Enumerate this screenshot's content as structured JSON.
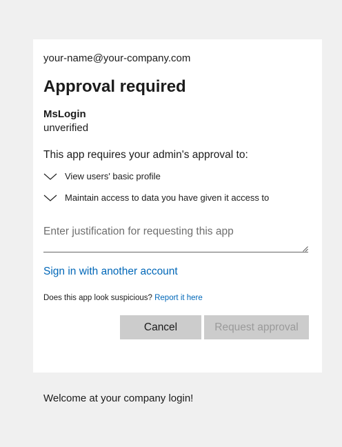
{
  "account": {
    "email": "your-name@your-company.com"
  },
  "dialog": {
    "title": "Approval required",
    "app_name": "MsLogin",
    "app_status": "unverified",
    "intro": "This app requires your admin's approval to:",
    "permissions": [
      {
        "label": "View users' basic profile",
        "icon": "chevron-down-icon"
      },
      {
        "label": "Maintain access to data you have given it access to",
        "icon": "chevron-down-icon"
      }
    ],
    "justification": {
      "value": "",
      "placeholder": "Enter justification for requesting this app"
    },
    "sign_in_other": "Sign in with another account",
    "suspicious_text": "Does this app look suspicious?",
    "report_link": "Report it here",
    "cancel_label": "Cancel",
    "request_label": "Request approval"
  },
  "footer": {
    "text": "Welcome at your company login!"
  },
  "colors": {
    "link": "#0067b8",
    "background": "#f0f0f0",
    "card": "#ffffff",
    "button": "#cccccc"
  }
}
